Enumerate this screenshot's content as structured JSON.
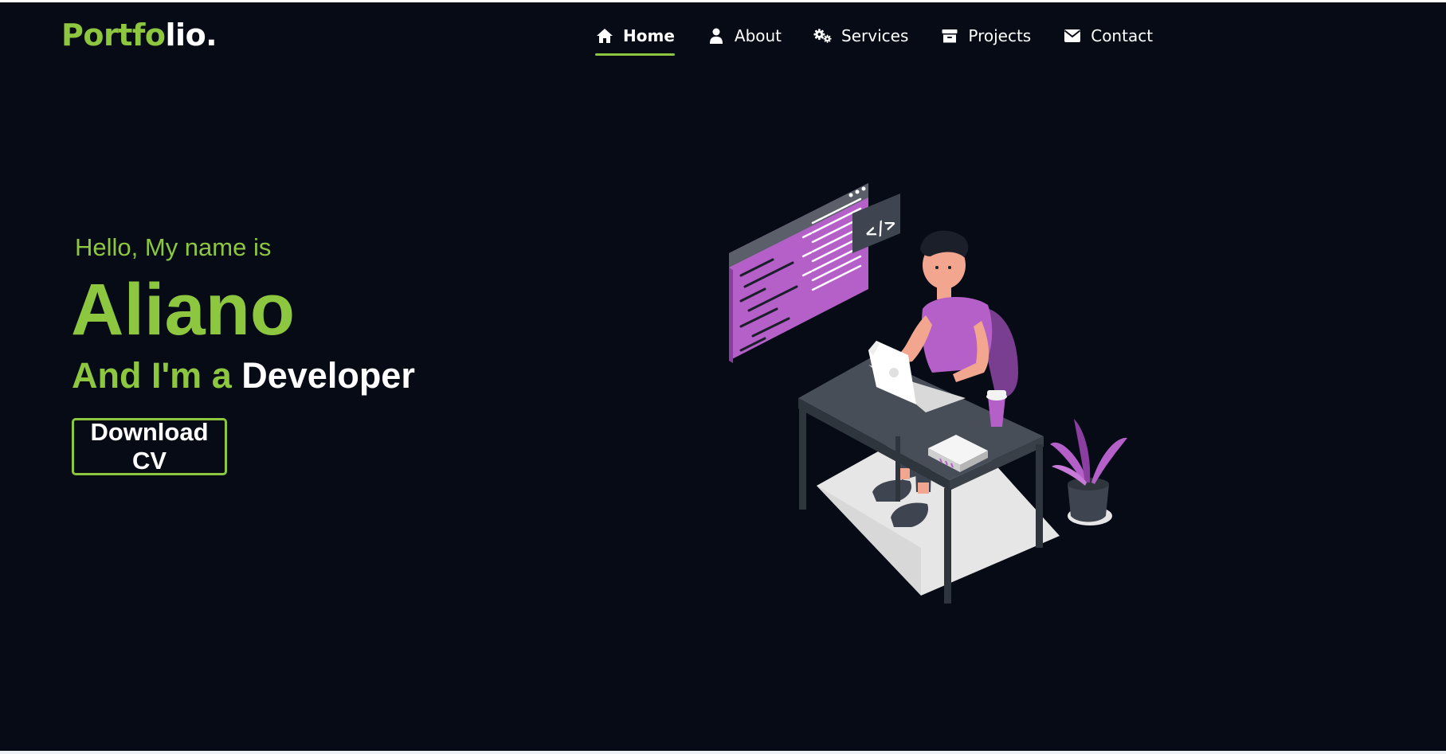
{
  "header": {
    "logo": {
      "part1": "Portfo",
      "part2": "lio."
    },
    "nav": [
      {
        "label": "Home",
        "icon": "home-icon",
        "active": true
      },
      {
        "label": "About",
        "icon": "user-icon",
        "active": false
      },
      {
        "label": "Services",
        "icon": "cogs-icon",
        "active": false
      },
      {
        "label": "Projects",
        "icon": "archive-icon",
        "active": false
      },
      {
        "label": "Contact",
        "icon": "envelope-icon",
        "active": false
      }
    ]
  },
  "hero": {
    "greeting": "Hello, My name is",
    "name": "Aliano",
    "role_prefix": "And I'm a",
    "role": "Developer",
    "cta_label": "Download CV",
    "illustration_icon": "developer-at-desk-illustration"
  },
  "colors": {
    "background": "#060b16",
    "accent": "#8dc63f",
    "text": "#ffffff",
    "illustration_purple": "#b55fc8"
  }
}
